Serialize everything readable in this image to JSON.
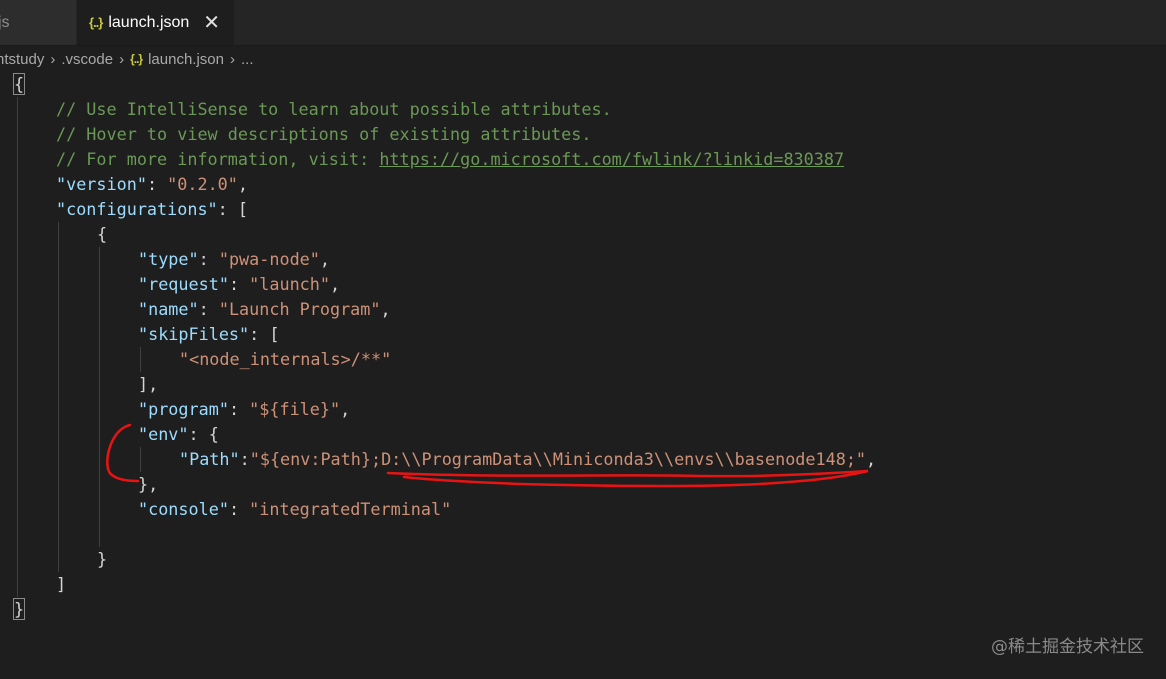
{
  "tabs": [
    {
      "label": "js",
      "active": false
    },
    {
      "label": "launch.json",
      "active": true,
      "icon": "json-icon",
      "close": "✕"
    }
  ],
  "breadcrumb": [
    {
      "label": "ntstudy"
    },
    {
      "label": ".vscode"
    },
    {
      "label": "launch.json",
      "icon": "json-icon"
    },
    {
      "label": "..."
    }
  ],
  "icons": {
    "json": "{..}",
    "chevron": "›"
  },
  "code": {
    "open_brace": "{",
    "comment1": "// Use IntelliSense to learn about possible attributes.",
    "comment2": "// Hover to view descriptions of existing attributes.",
    "comment3_prefix": "// For more information, visit: ",
    "comment3_link": "https://go.microsoft.com/fwlink/?linkid=830387",
    "version_key": "\"version\"",
    "version_val": "\"0.2.0\"",
    "configurations_key": "\"configurations\"",
    "type_key": "\"type\"",
    "type_val": "\"pwa-node\"",
    "request_key": "\"request\"",
    "request_val": "\"launch\"",
    "name_key": "\"name\"",
    "name_val": "\"Launch Program\"",
    "skipFiles_key": "\"skipFiles\"",
    "skipFiles_val": "\"<node_internals>/**\"",
    "program_key": "\"program\"",
    "program_val": "\"${file}\"",
    "env_key": "\"env\"",
    "path_key": "\"Path\"",
    "path_val": "\"${env:Path};D:\\\\ProgramData\\\\Miniconda3\\\\envs\\\\basenode148;\"",
    "console_key": "\"console\"",
    "console_val": "\"integratedTerminal\""
  },
  "watermark": "@稀土掘金技术社区",
  "colors": {
    "comment": "#6a9955",
    "key": "#9cdcfe",
    "string": "#ce9178",
    "annotation": "#e81414"
  }
}
